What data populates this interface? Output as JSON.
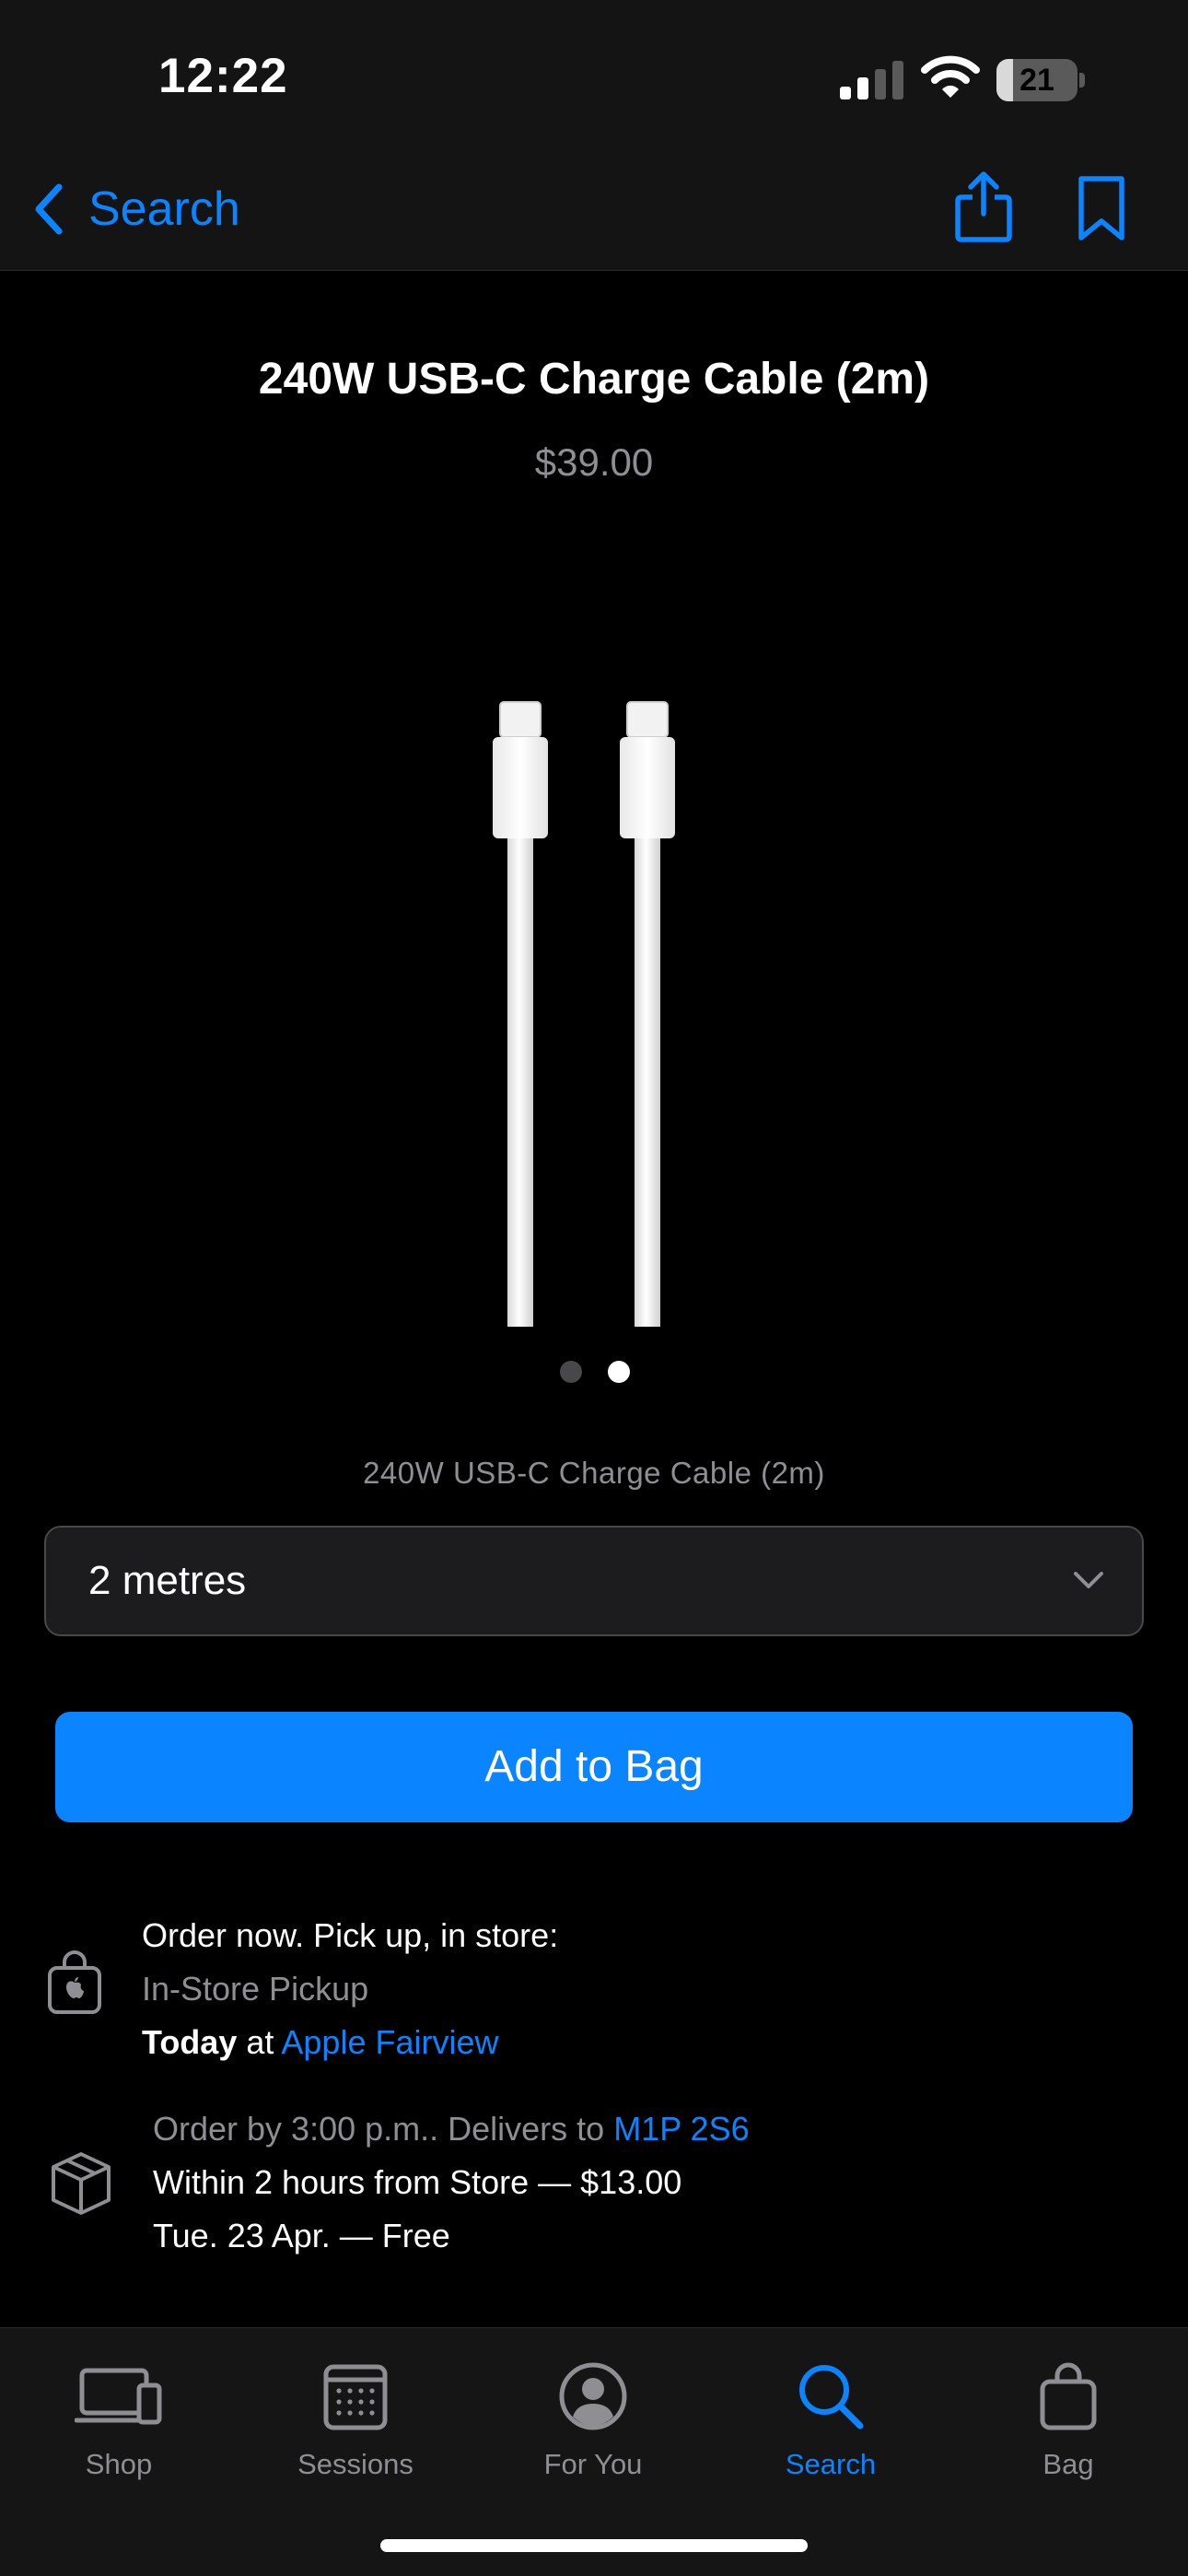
{
  "status_bar": {
    "time": "12:22",
    "battery_level": "21",
    "icons": [
      "cellular-signal-icon",
      "wifi-icon",
      "battery-icon"
    ]
  },
  "nav": {
    "back_label": "Search",
    "icons": [
      "chevron-left-icon",
      "share-icon",
      "bookmark-icon"
    ]
  },
  "product": {
    "title": "240W USB-C Charge Cable (2m)",
    "price": "$39.00",
    "image_caption": "240W USB-C Charge Cable (2m)",
    "gallery": {
      "pages": 2,
      "active_page": 2
    }
  },
  "length_select": {
    "value": "2 metres"
  },
  "add_to_bag_label": "Add to Bag",
  "pickup": {
    "heading": "Order now. Pick up, in store:",
    "method": "In-Store Pickup",
    "day": "Today",
    "at": " at ",
    "store": "Apple Fairview"
  },
  "delivery": {
    "order_by": "Order by 3:00 p.m.. Delivers to ",
    "postal_code": "M1P 2S6",
    "option_fast": "Within 2 hours from Store — $13.00",
    "option_free": "Tue. 23 Apr. — Free"
  },
  "tabs": [
    {
      "label": "Shop",
      "icon": "laptop-phone-icon",
      "active": false
    },
    {
      "label": "Sessions",
      "icon": "calendar-grid-icon",
      "active": false
    },
    {
      "label": "For You",
      "icon": "person-circle-icon",
      "active": false
    },
    {
      "label": "Search",
      "icon": "search-icon",
      "active": true
    },
    {
      "label": "Bag",
      "icon": "bag-icon",
      "active": false
    }
  ],
  "colors": {
    "accent": "#0a84ff",
    "background": "#000000",
    "bar_background": "#141414",
    "muted_text": "#8e8e93"
  }
}
